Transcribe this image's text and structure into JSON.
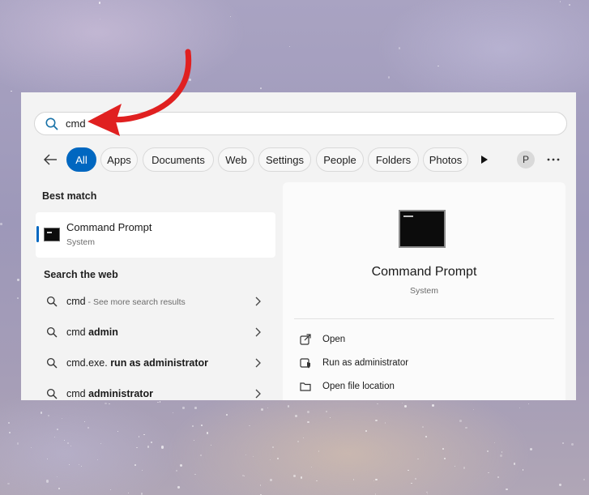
{
  "search": {
    "value": "cmd"
  },
  "filters": {
    "tabs": [
      {
        "label": "All",
        "active": true
      },
      {
        "label": "Apps"
      },
      {
        "label": "Documents"
      },
      {
        "label": "Web"
      },
      {
        "label": "Settings"
      },
      {
        "label": "People"
      },
      {
        "label": "Folders"
      },
      {
        "label": "Photos"
      }
    ],
    "avatar_letter": "P"
  },
  "best_match": {
    "heading": "Best match",
    "title": "Command Prompt",
    "subtitle": "System"
  },
  "web": {
    "heading": "Search the web",
    "results": [
      {
        "bold": "",
        "plain": "cmd",
        "muted": " - See more search results"
      },
      {
        "plain": "cmd ",
        "bold": "admin"
      },
      {
        "plain": "cmd.exe. ",
        "bold": "run as administrator"
      },
      {
        "plain": "cmd ",
        "bold": "administrator"
      }
    ]
  },
  "details": {
    "title": "Command Prompt",
    "subtitle": "System",
    "actions": [
      {
        "label": "Open",
        "icon": "open-external-icon"
      },
      {
        "label": "Run as administrator",
        "icon": "shield-icon"
      },
      {
        "label": "Open file location",
        "icon": "folder-icon"
      }
    ]
  },
  "colors": {
    "accent": "#0067c0",
    "annotation_arrow": "#e02020"
  }
}
